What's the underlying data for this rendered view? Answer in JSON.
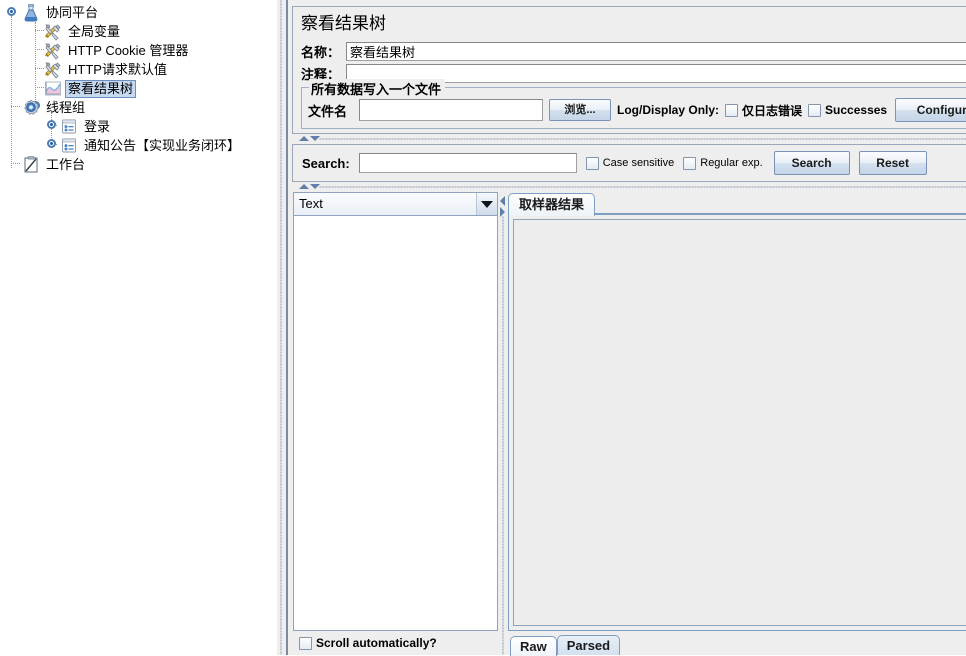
{
  "tree": {
    "nodes": [
      {
        "label": "协同平台",
        "icon": "test-plan-icon",
        "depth": 0,
        "selected": false,
        "expander": true
      },
      {
        "label": "全局变量",
        "icon": "config-element-icon",
        "depth": 1,
        "selected": false,
        "expander": false
      },
      {
        "label": "HTTP Cookie 管理器",
        "icon": "config-element-icon",
        "depth": 1,
        "selected": false,
        "expander": false
      },
      {
        "label": "HTTP请求默认值",
        "icon": "config-element-icon",
        "depth": 1,
        "selected": false,
        "expander": false
      },
      {
        "label": "察看结果树",
        "icon": "view-results-tree-icon",
        "depth": 1,
        "selected": true,
        "expander": false
      },
      {
        "label": "线程组",
        "icon": "thread-group-icon",
        "depth": 1,
        "selected": false,
        "expander": true
      },
      {
        "label": "登录",
        "icon": "http-sampler-icon",
        "depth": 2,
        "selected": false,
        "expander": true
      },
      {
        "label": "通知公告【实现业务闭环】",
        "icon": "http-sampler-icon",
        "depth": 2,
        "selected": false,
        "expander": true
      },
      {
        "label": "工作台",
        "icon": "workbench-icon",
        "depth": 0,
        "selected": false,
        "expander": false
      }
    ]
  },
  "panel": {
    "title": "察看结果树",
    "name_label": "名称：",
    "name_value": "察看结果树",
    "comment_label": "注释：",
    "comment_value": "",
    "file_group": {
      "title": "所有数据写入一个文件",
      "filename_label": "文件名",
      "filename_value": "",
      "filename_placeholder": "",
      "browse_label": "浏览...",
      "logdisplay_label": "Log/Display Only:",
      "errors_only_label": "仅日志错误",
      "errors_only_checked": false,
      "successes_label": "Successes",
      "successes_checked": false,
      "configure_label": "Configure"
    }
  },
  "search": {
    "label": "Search:",
    "value": "",
    "placeholder": "",
    "case_sensitive_label": "Case sensitive",
    "case_sensitive_checked": false,
    "regular_exp_label": "Regular exp.",
    "regular_exp_checked": false,
    "search_button": "Search",
    "reset_button": "Reset"
  },
  "results": {
    "renderer_selected": "Text",
    "scroll_automatically_label": "Scroll automatically?",
    "scroll_automatically_checked": false,
    "tabs": [
      {
        "label": "取样器结果",
        "active": true
      }
    ],
    "bottom_tabs": [
      {
        "label": "Raw",
        "active": true
      },
      {
        "label": "Parsed",
        "active": false
      }
    ],
    "content": ""
  },
  "colors": {
    "selection_bg": "#c6d9f0",
    "selection_border": "#6a8fc0",
    "panel_bg": "#eeeeee",
    "border": "#9aa7b8",
    "tab_border": "#7e9ec4",
    "tree_line": "#7a9cc6"
  }
}
